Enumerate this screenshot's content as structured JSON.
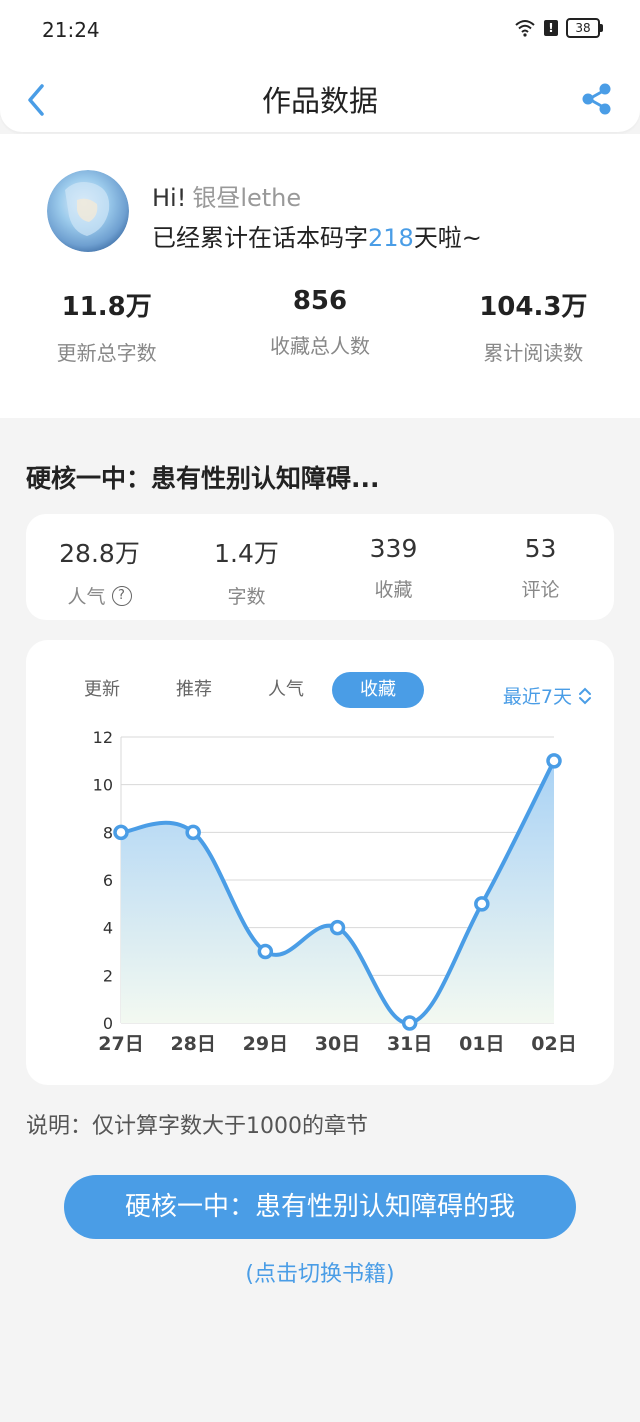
{
  "status_bar": {
    "time": "21:24",
    "battery": "38"
  },
  "nav": {
    "title": "作品数据"
  },
  "profile": {
    "greeting": "Hi!",
    "username": "银昼lethe",
    "days_prefix": "已经累计在话本码字",
    "days_value": "218",
    "days_suffix": "天啦~",
    "stats": [
      {
        "value": "11.8万",
        "label": "更新总字数"
      },
      {
        "value": "856",
        "label": "收藏总人数"
      },
      {
        "value": "104.3万",
        "label": "累计阅读数"
      }
    ]
  },
  "book": {
    "title": "硬核一中：患有性别认知障碍...",
    "stats": [
      {
        "value": "28.8万",
        "label": "人气"
      },
      {
        "value": "1.4万",
        "label": "字数"
      },
      {
        "value": "339",
        "label": "收藏"
      },
      {
        "value": "53",
        "label": "评论"
      }
    ]
  },
  "chart_tabs": [
    "更新",
    "推荐",
    "人气",
    "收藏"
  ],
  "active_tab": "收藏",
  "range_label": "最近7天",
  "chart_data": {
    "type": "area",
    "categories": [
      "27日",
      "28日",
      "29日",
      "30日",
      "31日",
      "01日",
      "02日"
    ],
    "values": [
      8,
      8,
      3,
      4,
      0,
      5,
      11
    ],
    "ylim": [
      0,
      12
    ],
    "yticks": [
      0,
      2,
      4,
      6,
      8,
      10,
      12
    ],
    "grid": true,
    "colors": {
      "line": "#4a9de6",
      "fill_top": "#a9d2f5",
      "fill_bottom": "#f3f9f1"
    }
  },
  "note": "说明：仅计算字数大于1000的章节",
  "main_button": "硬核一中：患有性别认知障碍的我",
  "switch_link": "(点击切换书籍)",
  "colors": {
    "accent": "#4a9de6"
  }
}
